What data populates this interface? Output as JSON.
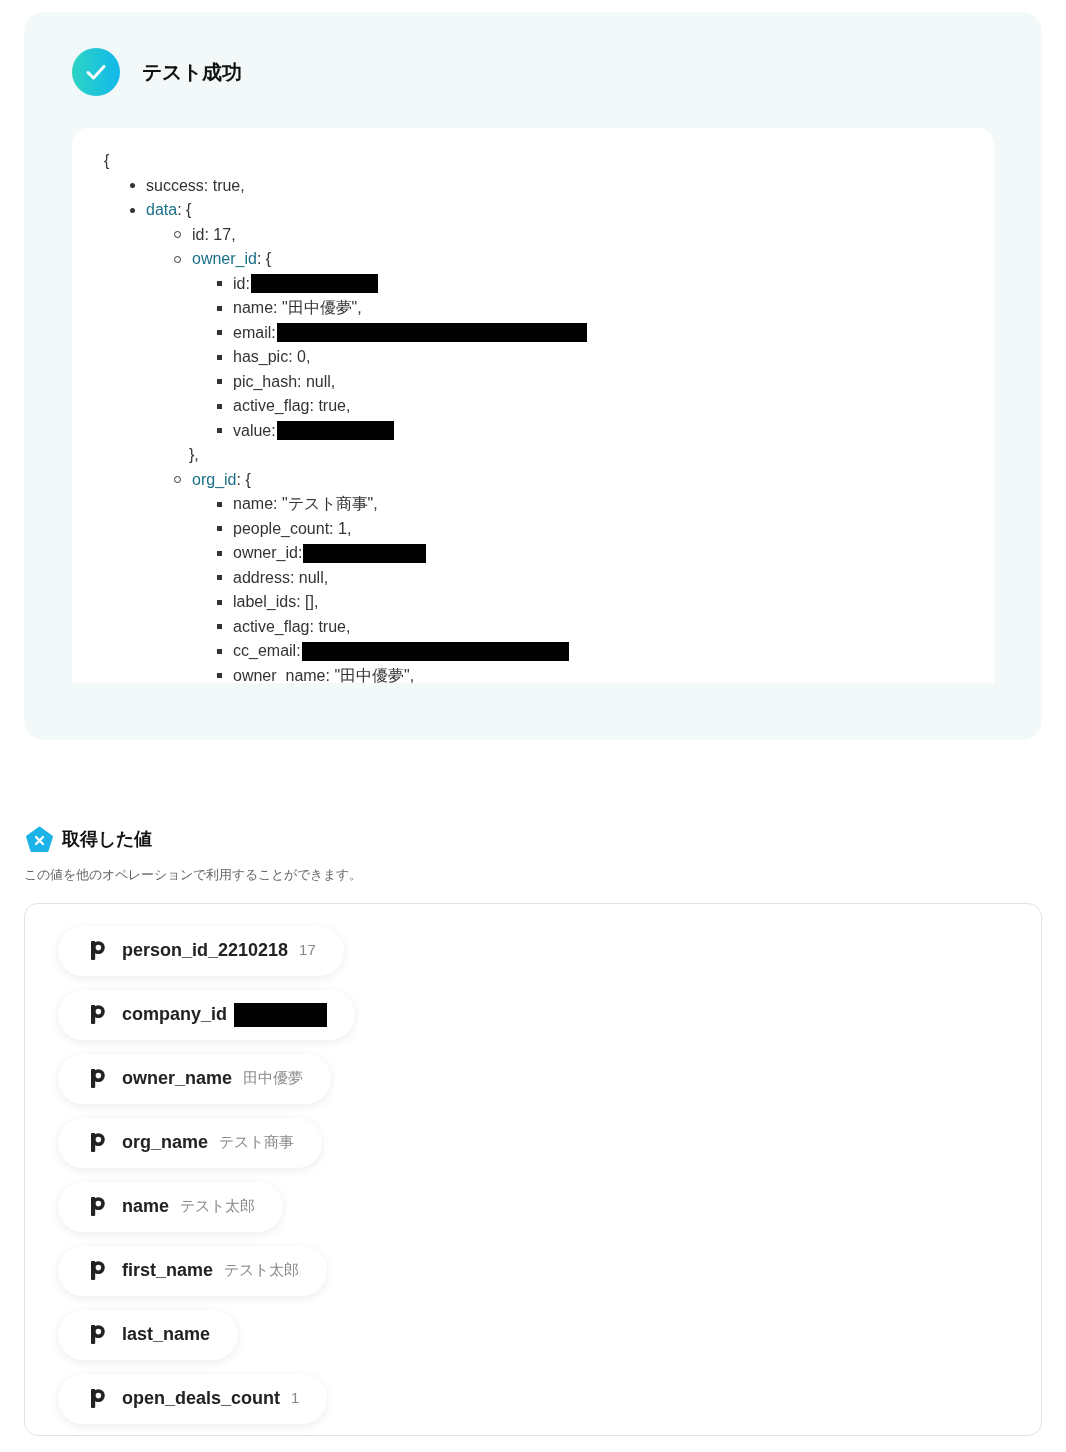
{
  "test_result": {
    "title": "テスト成功",
    "code": {
      "open": "{",
      "items": [
        {
          "kind": "entry",
          "text": "success: true,"
        },
        {
          "kind": "object",
          "key": "data",
          "text": ": {",
          "children": [
            {
              "kind": "entry",
              "text": "id: 17,"
            },
            {
              "kind": "object",
              "key": "owner_id",
              "text": ": {",
              "children": [
                {
                  "kind": "entry",
                  "text": "id:",
                  "redacted": true
                },
                {
                  "kind": "entry",
                  "text": "name: \"田中優夢\","
                },
                {
                  "kind": "entry",
                  "text": "email:",
                  "redacted": true
                },
                {
                  "kind": "entry",
                  "text": "has_pic: 0,"
                },
                {
                  "kind": "entry",
                  "text": "pic_hash: null,"
                },
                {
                  "kind": "entry",
                  "text": "active_flag: true,"
                },
                {
                  "kind": "entry",
                  "text": "value:",
                  "redacted": true
                }
              ]
            },
            {
              "kind": "close",
              "text": "},"
            },
            {
              "kind": "object",
              "key": "org_id",
              "text": ": {",
              "children": [
                {
                  "kind": "entry",
                  "text": "name: \"テスト商事\","
                },
                {
                  "kind": "entry",
                  "text": "people_count: 1,"
                },
                {
                  "kind": "entry",
                  "text": "owner_id:",
                  "redacted": true
                },
                {
                  "kind": "entry",
                  "text": "address: null,"
                },
                {
                  "kind": "entry",
                  "text": "label_ids: [],"
                },
                {
                  "kind": "entry",
                  "text": "active_flag: true,"
                },
                {
                  "kind": "entry",
                  "text": "cc_email:",
                  "redacted": true
                },
                {
                  "kind": "entry",
                  "text": "owner_name: \"田中優夢\","
                }
              ]
            }
          ]
        }
      ]
    }
  },
  "values": {
    "title": "取得した値",
    "description": "この値を他のオペレーションで利用することができます。",
    "items": [
      {
        "name": "person_id_2210218",
        "value": "17"
      },
      {
        "name": "company_id",
        "redacted": true
      },
      {
        "name": "owner_name",
        "value": "田中優夢"
      },
      {
        "name": "org_name",
        "value": "テスト商事"
      },
      {
        "name": "name",
        "value": "テスト太郎"
      },
      {
        "name": "first_name",
        "value": "テスト太郎"
      },
      {
        "name": "last_name"
      },
      {
        "name": "open_deals_count",
        "value": "1"
      }
    ]
  }
}
